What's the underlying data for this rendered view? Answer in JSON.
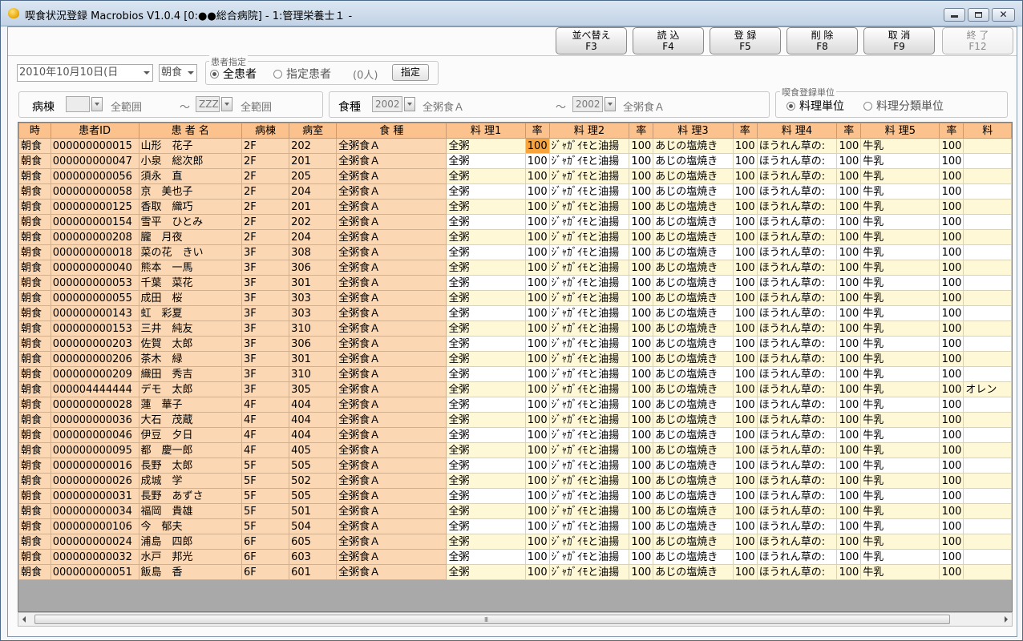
{
  "window": {
    "title": "喫食状況登録 Macrobios V1.0.4 [0:●●総合病院]  - 1:管理栄養士１ -",
    "min_icon": "minimize-icon",
    "max_icon": "maximize-icon",
    "close_icon": "close-icon"
  },
  "toolbar": {
    "buttons": [
      {
        "label": "並べ替え",
        "key": "F3"
      },
      {
        "label": "読 込",
        "key": "F4"
      },
      {
        "label": "登 録",
        "key": "F5"
      },
      {
        "label": "削 除",
        "key": "F8"
      },
      {
        "label": "取 消",
        "key": "F9"
      },
      {
        "label": "終 了",
        "key": "F12"
      }
    ]
  },
  "filters": {
    "date": "2010年10月10日(日",
    "meal": "朝食",
    "patient_group_label": "患者指定",
    "all_patients": "全患者",
    "specified_patients": "指定患者",
    "count": "(0人)",
    "specify_button": "指定",
    "ward_label": "病棟",
    "ward_from_code": "",
    "ward_from_text": "全範囲",
    "tilde1": "～",
    "ward_to_code": "ZZZ",
    "ward_to_text": "全範囲",
    "diet_label": "食種",
    "diet_from_code": "2002",
    "diet_from_text": "全粥食Ａ",
    "tilde2": "～",
    "diet_to_code": "2002",
    "diet_to_text": "全粥食Ａ",
    "unit_group_label": "喫食登録単位",
    "unit_dish": "料理単位",
    "unit_category": "料理分類単位"
  },
  "grid": {
    "headers": [
      "時",
      "患者ID",
      "患 者 名",
      "病棟",
      "病室",
      "食 種",
      "料 理1",
      "率",
      "料 理2",
      "率",
      "料 理3",
      "率",
      "料 理4",
      "率",
      "料 理5",
      "率",
      "料"
    ],
    "common": {
      "meal": "朝食",
      "diet": "全粥食Ａ",
      "dish1": "全粥",
      "dish2": "ｼﾞｬｶﾞｲﾓと油揚",
      "dish3": "あじの塩焼き",
      "dish4": "ほうれん草の:",
      "dish5": "牛乳",
      "rate": "100"
    },
    "extra_dish": "オレン",
    "rows": [
      {
        "id": "000000000015",
        "name": "山形　花子",
        "ward": "2F",
        "room": "202"
      },
      {
        "id": "000000000047",
        "name": "小泉　総次郎",
        "ward": "2F",
        "room": "201"
      },
      {
        "id": "000000000056",
        "name": "須永　直",
        "ward": "2F",
        "room": "205"
      },
      {
        "id": "000000000058",
        "name": "京　美也子",
        "ward": "2F",
        "room": "204"
      },
      {
        "id": "000000000125",
        "name": "香取　織巧",
        "ward": "2F",
        "room": "201"
      },
      {
        "id": "000000000154",
        "name": "雪平　ひとみ",
        "ward": "2F",
        "room": "202"
      },
      {
        "id": "000000000208",
        "name": "朧　月夜",
        "ward": "2F",
        "room": "204"
      },
      {
        "id": "000000000018",
        "name": "菜の花　きい",
        "ward": "3F",
        "room": "308"
      },
      {
        "id": "000000000040",
        "name": "熊本　一馬",
        "ward": "3F",
        "room": "306"
      },
      {
        "id": "000000000053",
        "name": "千葉　菜花",
        "ward": "3F",
        "room": "301"
      },
      {
        "id": "000000000055",
        "name": "成田　桜",
        "ward": "3F",
        "room": "303"
      },
      {
        "id": "000000000143",
        "name": "虹　彩夏",
        "ward": "3F",
        "room": "303"
      },
      {
        "id": "000000000153",
        "name": "三井　純友",
        "ward": "3F",
        "room": "310"
      },
      {
        "id": "000000000203",
        "name": "佐賀　太郎",
        "ward": "3F",
        "room": "306"
      },
      {
        "id": "000000000206",
        "name": "茶木　緑",
        "ward": "3F",
        "room": "301"
      },
      {
        "id": "000000000209",
        "name": "織田　秀吉",
        "ward": "3F",
        "room": "310"
      },
      {
        "id": "000004444444",
        "name": "デモ　太郎",
        "ward": "3F",
        "room": "305"
      },
      {
        "id": "000000000028",
        "name": "蓮　華子",
        "ward": "4F",
        "room": "404"
      },
      {
        "id": "000000000036",
        "name": "大石　茂蔵",
        "ward": "4F",
        "room": "404"
      },
      {
        "id": "000000000046",
        "name": "伊豆　夕日",
        "ward": "4F",
        "room": "404"
      },
      {
        "id": "000000000095",
        "name": "都　慶一郎",
        "ward": "4F",
        "room": "405"
      },
      {
        "id": "000000000016",
        "name": "長野　太郎",
        "ward": "5F",
        "room": "505"
      },
      {
        "id": "000000000026",
        "name": "成城　学",
        "ward": "5F",
        "room": "502"
      },
      {
        "id": "000000000031",
        "name": "長野　あずさ",
        "ward": "5F",
        "room": "505"
      },
      {
        "id": "000000000034",
        "name": "福岡　貴雄",
        "ward": "5F",
        "room": "501"
      },
      {
        "id": "000000000106",
        "name": "今　郁夫",
        "ward": "5F",
        "room": "504"
      },
      {
        "id": "000000000024",
        "name": "浦島　四郎",
        "ward": "6F",
        "room": "605"
      },
      {
        "id": "000000000032",
        "name": "水戸　邦光",
        "ward": "6F",
        "room": "603"
      },
      {
        "id": "000000000051",
        "name": "飯島　香",
        "ward": "6F",
        "room": "601"
      }
    ]
  },
  "scrollbar": {
    "grip": "III"
  }
}
